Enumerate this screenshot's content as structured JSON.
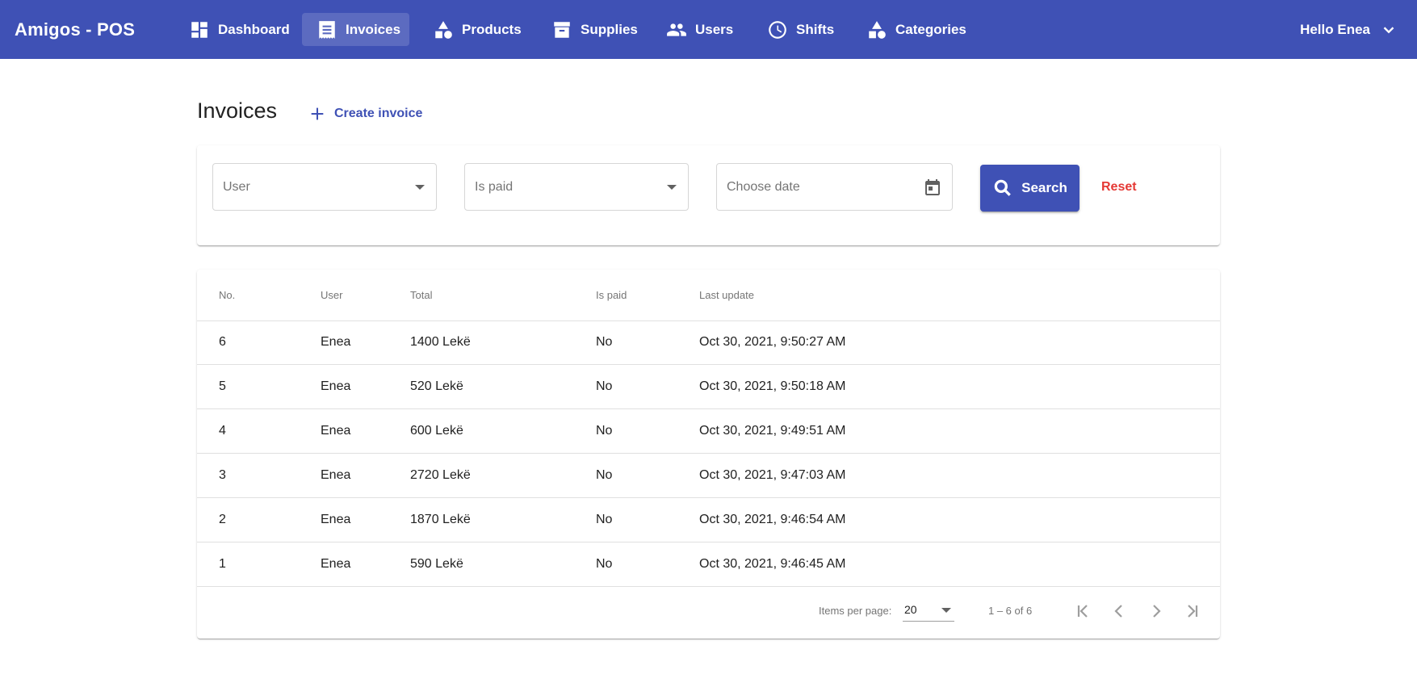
{
  "app": {
    "title": "Amigos - POS"
  },
  "nav": {
    "items": [
      {
        "label": "Dashboard",
        "icon": "dashboard-icon"
      },
      {
        "label": "Invoices",
        "icon": "receipt-icon",
        "active": true
      },
      {
        "label": "Products",
        "icon": "category-shapes-icon"
      },
      {
        "label": "Supplies",
        "icon": "archive-icon"
      },
      {
        "label": "Users",
        "icon": "people-icon"
      },
      {
        "label": "Shifts",
        "icon": "clock-icon"
      },
      {
        "label": "Categories",
        "icon": "category-shapes-icon"
      }
    ],
    "greeting": "Hello Enea"
  },
  "page": {
    "title": "Invoices",
    "create_label": "Create invoice"
  },
  "filters": {
    "user_placeholder": "User",
    "paid_placeholder": "Is paid",
    "date_placeholder": "Choose date",
    "search_label": "Search",
    "reset_label": "Reset"
  },
  "table": {
    "headers": {
      "no": "No.",
      "user": "User",
      "total": "Total",
      "paid": "Is paid",
      "updated": "Last update"
    },
    "rows": [
      {
        "no": "6",
        "user": "Enea",
        "total": "1400 Lekë",
        "paid": "No",
        "updated": "Oct 30, 2021, 9:50:27 AM"
      },
      {
        "no": "5",
        "user": "Enea",
        "total": "520 Lekë",
        "paid": "No",
        "updated": "Oct 30, 2021, 9:50:18 AM"
      },
      {
        "no": "4",
        "user": "Enea",
        "total": "600 Lekë",
        "paid": "No",
        "updated": "Oct 30, 2021, 9:49:51 AM"
      },
      {
        "no": "3",
        "user": "Enea",
        "total": "2720 Lekë",
        "paid": "No",
        "updated": "Oct 30, 2021, 9:47:03 AM"
      },
      {
        "no": "2",
        "user": "Enea",
        "total": "1870 Lekë",
        "paid": "No",
        "updated": "Oct 30, 2021, 9:46:54 AM"
      },
      {
        "no": "1",
        "user": "Enea",
        "total": "590 Lekë",
        "paid": "No",
        "updated": "Oct 30, 2021, 9:46:45 AM"
      }
    ]
  },
  "paginator": {
    "items_per_page_label": "Items per page:",
    "items_per_page": "20",
    "range": "1 – 6 of 6"
  },
  "colors": {
    "primary": "#3f51b5",
    "active_nav": "#5c6bc0",
    "danger": "#e53935"
  }
}
